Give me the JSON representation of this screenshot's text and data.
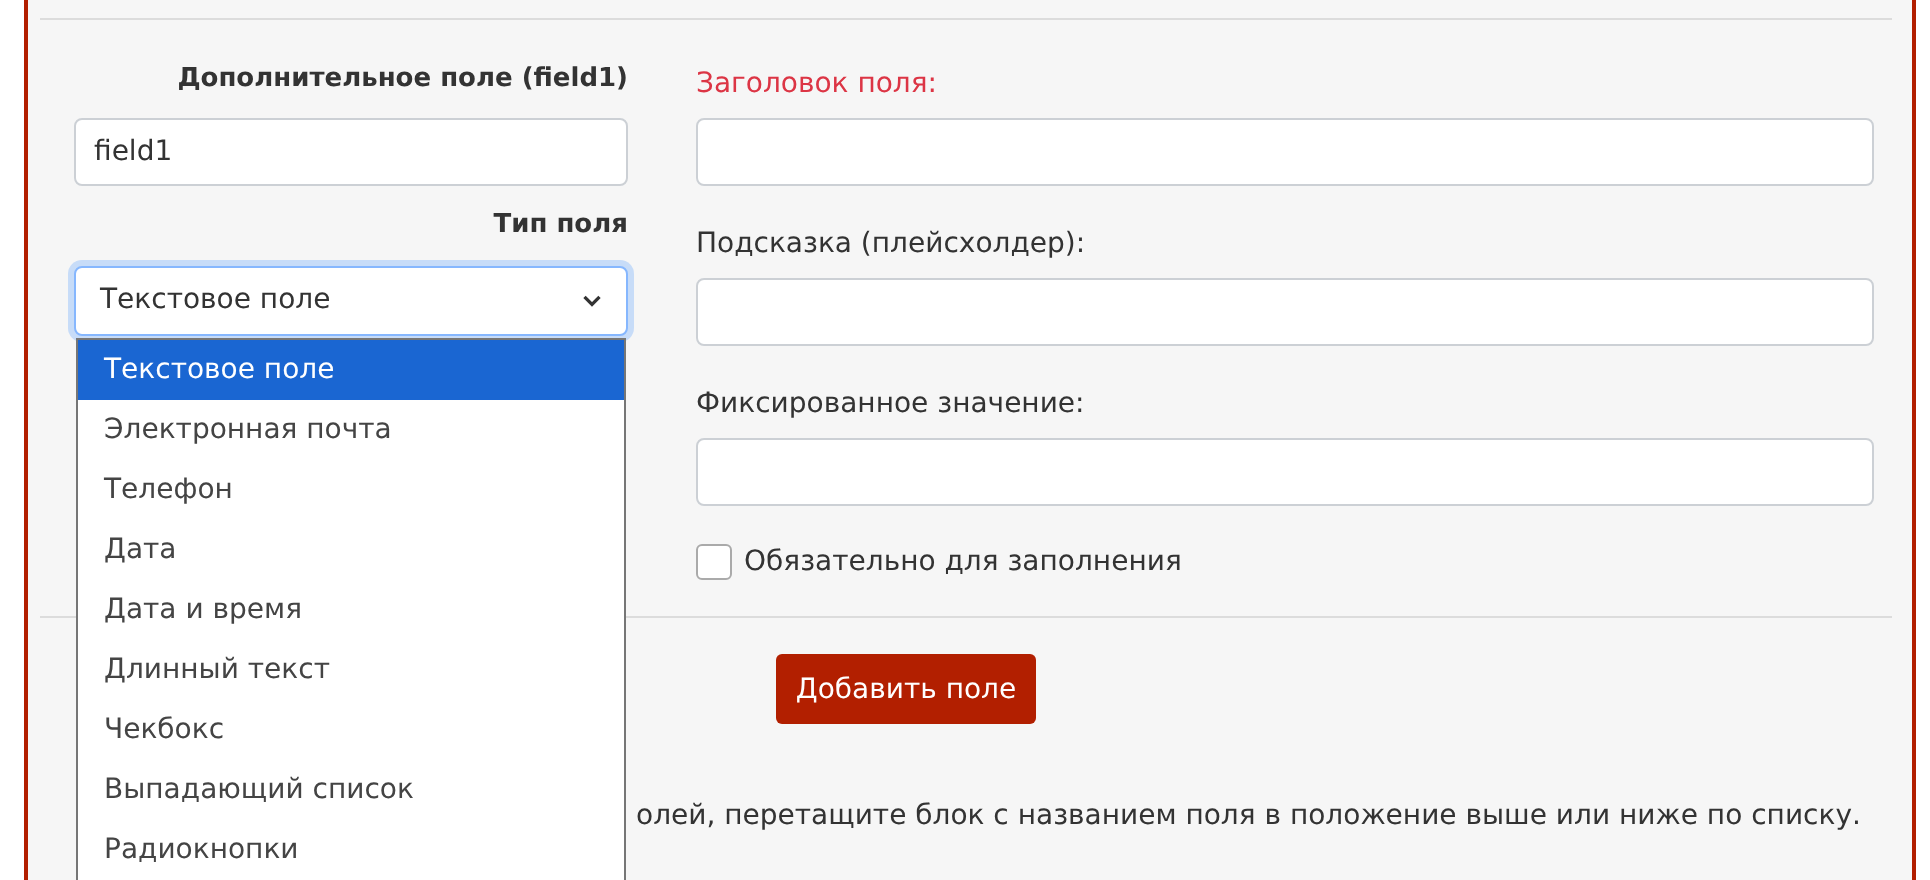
{
  "left": {
    "field_heading": "Дополнительное поле (field1)",
    "field_id": {
      "value": "field1"
    },
    "type_label": "Тип поля",
    "type_select": {
      "value": "Текстовое поле",
      "expanded": true,
      "options": [
        {
          "label": "Текстовое поле",
          "selected": true
        },
        {
          "label": "Электронная почта",
          "selected": false
        },
        {
          "label": "Телефон",
          "selected": false
        },
        {
          "label": "Дата",
          "selected": false
        },
        {
          "label": "Дата и время",
          "selected": false
        },
        {
          "label": "Длинный текст",
          "selected": false
        },
        {
          "label": "Чекбокс",
          "selected": false
        },
        {
          "label": "Выпадающий список",
          "selected": false
        },
        {
          "label": "Радиокнопки",
          "selected": false
        }
      ]
    }
  },
  "right": {
    "fields": [
      {
        "label": "Заголовок поля:",
        "required": true
      },
      {
        "label": "Подсказка (плейсхолдер):",
        "required": false
      },
      {
        "label": "Фиксированное значение:",
        "required": false
      }
    ],
    "required_checkbox": {
      "label": "Обязательно для заполнения",
      "checked": false
    }
  },
  "add_button": "Добавить поле",
  "hint_text": "олей, перетащите блок с названием поля в положение выше или ниже по списку."
}
